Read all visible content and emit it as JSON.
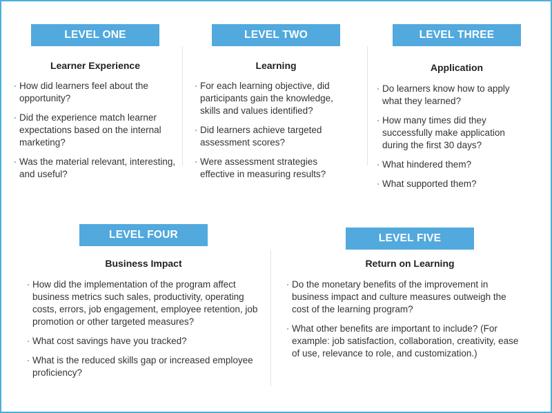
{
  "accent_color": "#52a9dd",
  "levels": [
    {
      "label": "LEVEL ONE",
      "heading": "Learner Experience",
      "items": [
        "How did learners feel about the opportunity?",
        "Did the experience match learner expectations based on the internal marketing?",
        "Was the material relevant, interesting, and useful?"
      ]
    },
    {
      "label": "LEVEL TWO",
      "heading": "Learning",
      "items": [
        "For each learning objective, did participants gain the knowledge, skills and values identified?",
        "Did learners achieve targeted assessment scores?",
        "Were assessment strategies effective in measuring results?"
      ]
    },
    {
      "label": "LEVEL THREE",
      "heading": "Application",
      "items": [
        "Do learners know how to apply what they learned?",
        "How many times did they successfully make application during the first 30 days?",
        "What hindered them?",
        "What supported them?"
      ]
    },
    {
      "label": "LEVEL FOUR",
      "heading": "Business Impact",
      "items": [
        "How did the implementation of the program affect business metrics such sales, productivity, operating costs, errors, job engagement, employee retention, job promotion or other targeted measures?",
        "What cost savings have you tracked?",
        "What is the reduced skills gap or increased employee proficiency?"
      ]
    },
    {
      "label": "LEVEL FIVE",
      "heading": "Return on Learning",
      "items": [
        "Do the monetary benefits of the improvement in business impact and culture measures outweigh the cost of the learning program?",
        "What other benefits are important to include? (For example: job satisfaction, collaboration, creativity, ease of use, relevance to role, and customization.)"
      ]
    }
  ]
}
